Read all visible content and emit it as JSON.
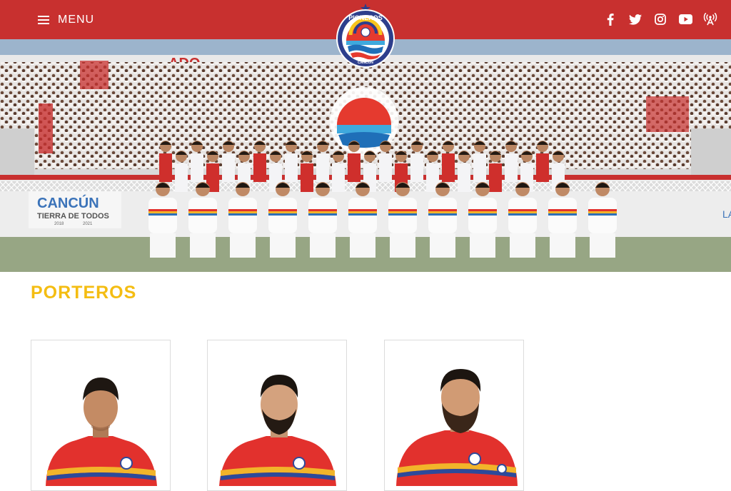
{
  "header": {
    "menu_label": "MENU",
    "background_color": "#c8302f",
    "socials": [
      {
        "icon": "facebook-icon"
      },
      {
        "icon": "twitter-icon"
      },
      {
        "icon": "instagram-icon"
      },
      {
        "icon": "youtube-icon"
      },
      {
        "icon": "radio-broadcast-icon"
      }
    ]
  },
  "logo": {
    "text_top": "PIONEROS",
    "text_bottom": "CANCÚN"
  },
  "hero": {
    "banner_text_1": "ADO",
    "sign_title": "CANCÚN",
    "sign_subtitle": "TIERRA DE TODOS",
    "sign_years_start": "2018",
    "sign_years_end": "2021",
    "edge_text": "LA"
  },
  "section": {
    "title": "PORTEROS",
    "title_color": "#f4bd12"
  },
  "players": [
    {
      "jersey_color": "#e2312d"
    },
    {
      "jersey_color": "#e2312d"
    },
    {
      "jersey_color": "#e2312d"
    }
  ]
}
